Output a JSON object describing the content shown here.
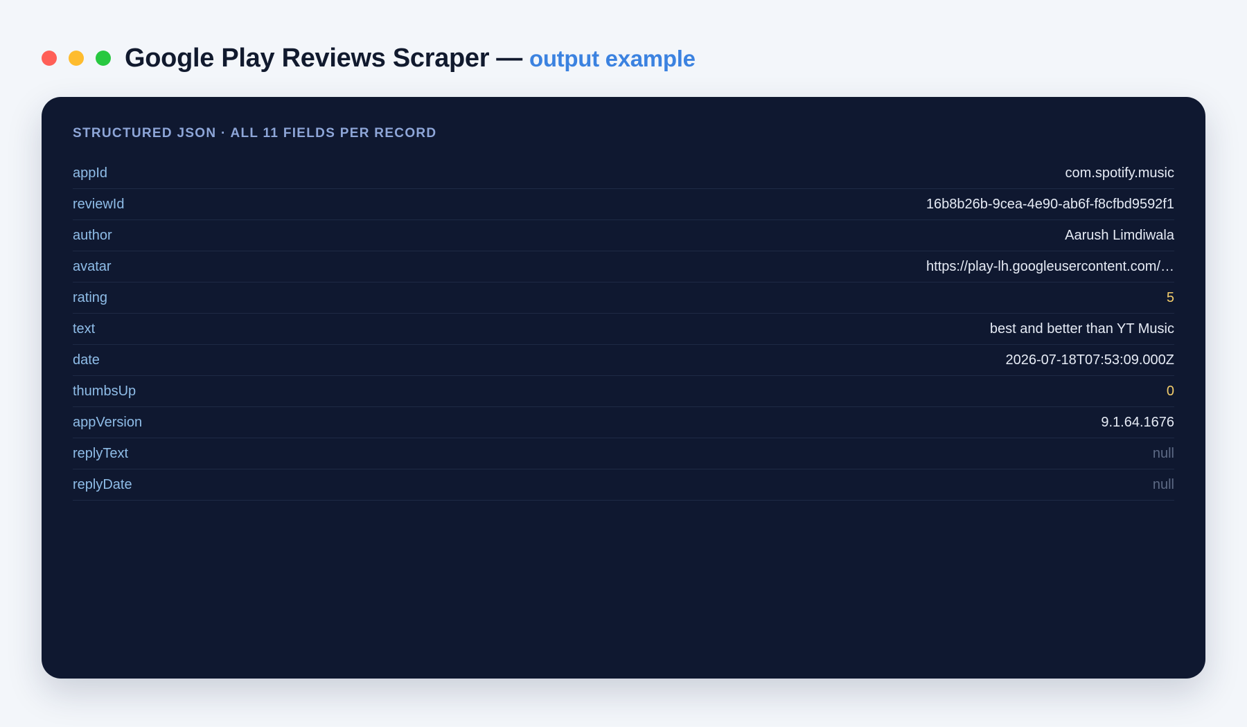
{
  "header": {
    "title": "Google Play Reviews Scraper",
    "separator": "—",
    "subtitle": "output example",
    "window_dots": [
      "#ff5f57",
      "#febc2e",
      "#28c840"
    ]
  },
  "panel": {
    "heading": "STRUCTURED JSON · ALL 11 FIELDS PER RECORD",
    "rows": [
      {
        "key": "appId",
        "value": "com.spotify.music",
        "type": "string"
      },
      {
        "key": "reviewId",
        "value": "16b8b26b-9cea-4e90-ab6f-f8cfbd9592f1",
        "type": "string"
      },
      {
        "key": "author",
        "value": "Aarush Limdiwala",
        "type": "string"
      },
      {
        "key": "avatar",
        "value": "https://play-lh.googleusercontent.com/…",
        "type": "string"
      },
      {
        "key": "rating",
        "value": "5",
        "type": "number"
      },
      {
        "key": "text",
        "value": "best and better than YT Music",
        "type": "string"
      },
      {
        "key": "date",
        "value": "2026-07-18T07:53:09.000Z",
        "type": "string"
      },
      {
        "key": "thumbsUp",
        "value": "0",
        "type": "number"
      },
      {
        "key": "appVersion",
        "value": "9.1.64.1676",
        "type": "string"
      },
      {
        "key": "replyText",
        "value": "null",
        "type": "null"
      },
      {
        "key": "replyDate",
        "value": "null",
        "type": "null"
      }
    ]
  },
  "colors": {
    "background": "#f3f6fa",
    "panel": "#0f1830",
    "title": "#111a2e",
    "subtitle": "#3b82e0",
    "key": "#8fbde8",
    "string": "#e6ebf5",
    "number": "#f2cc6b",
    "null": "#5d6a85"
  }
}
